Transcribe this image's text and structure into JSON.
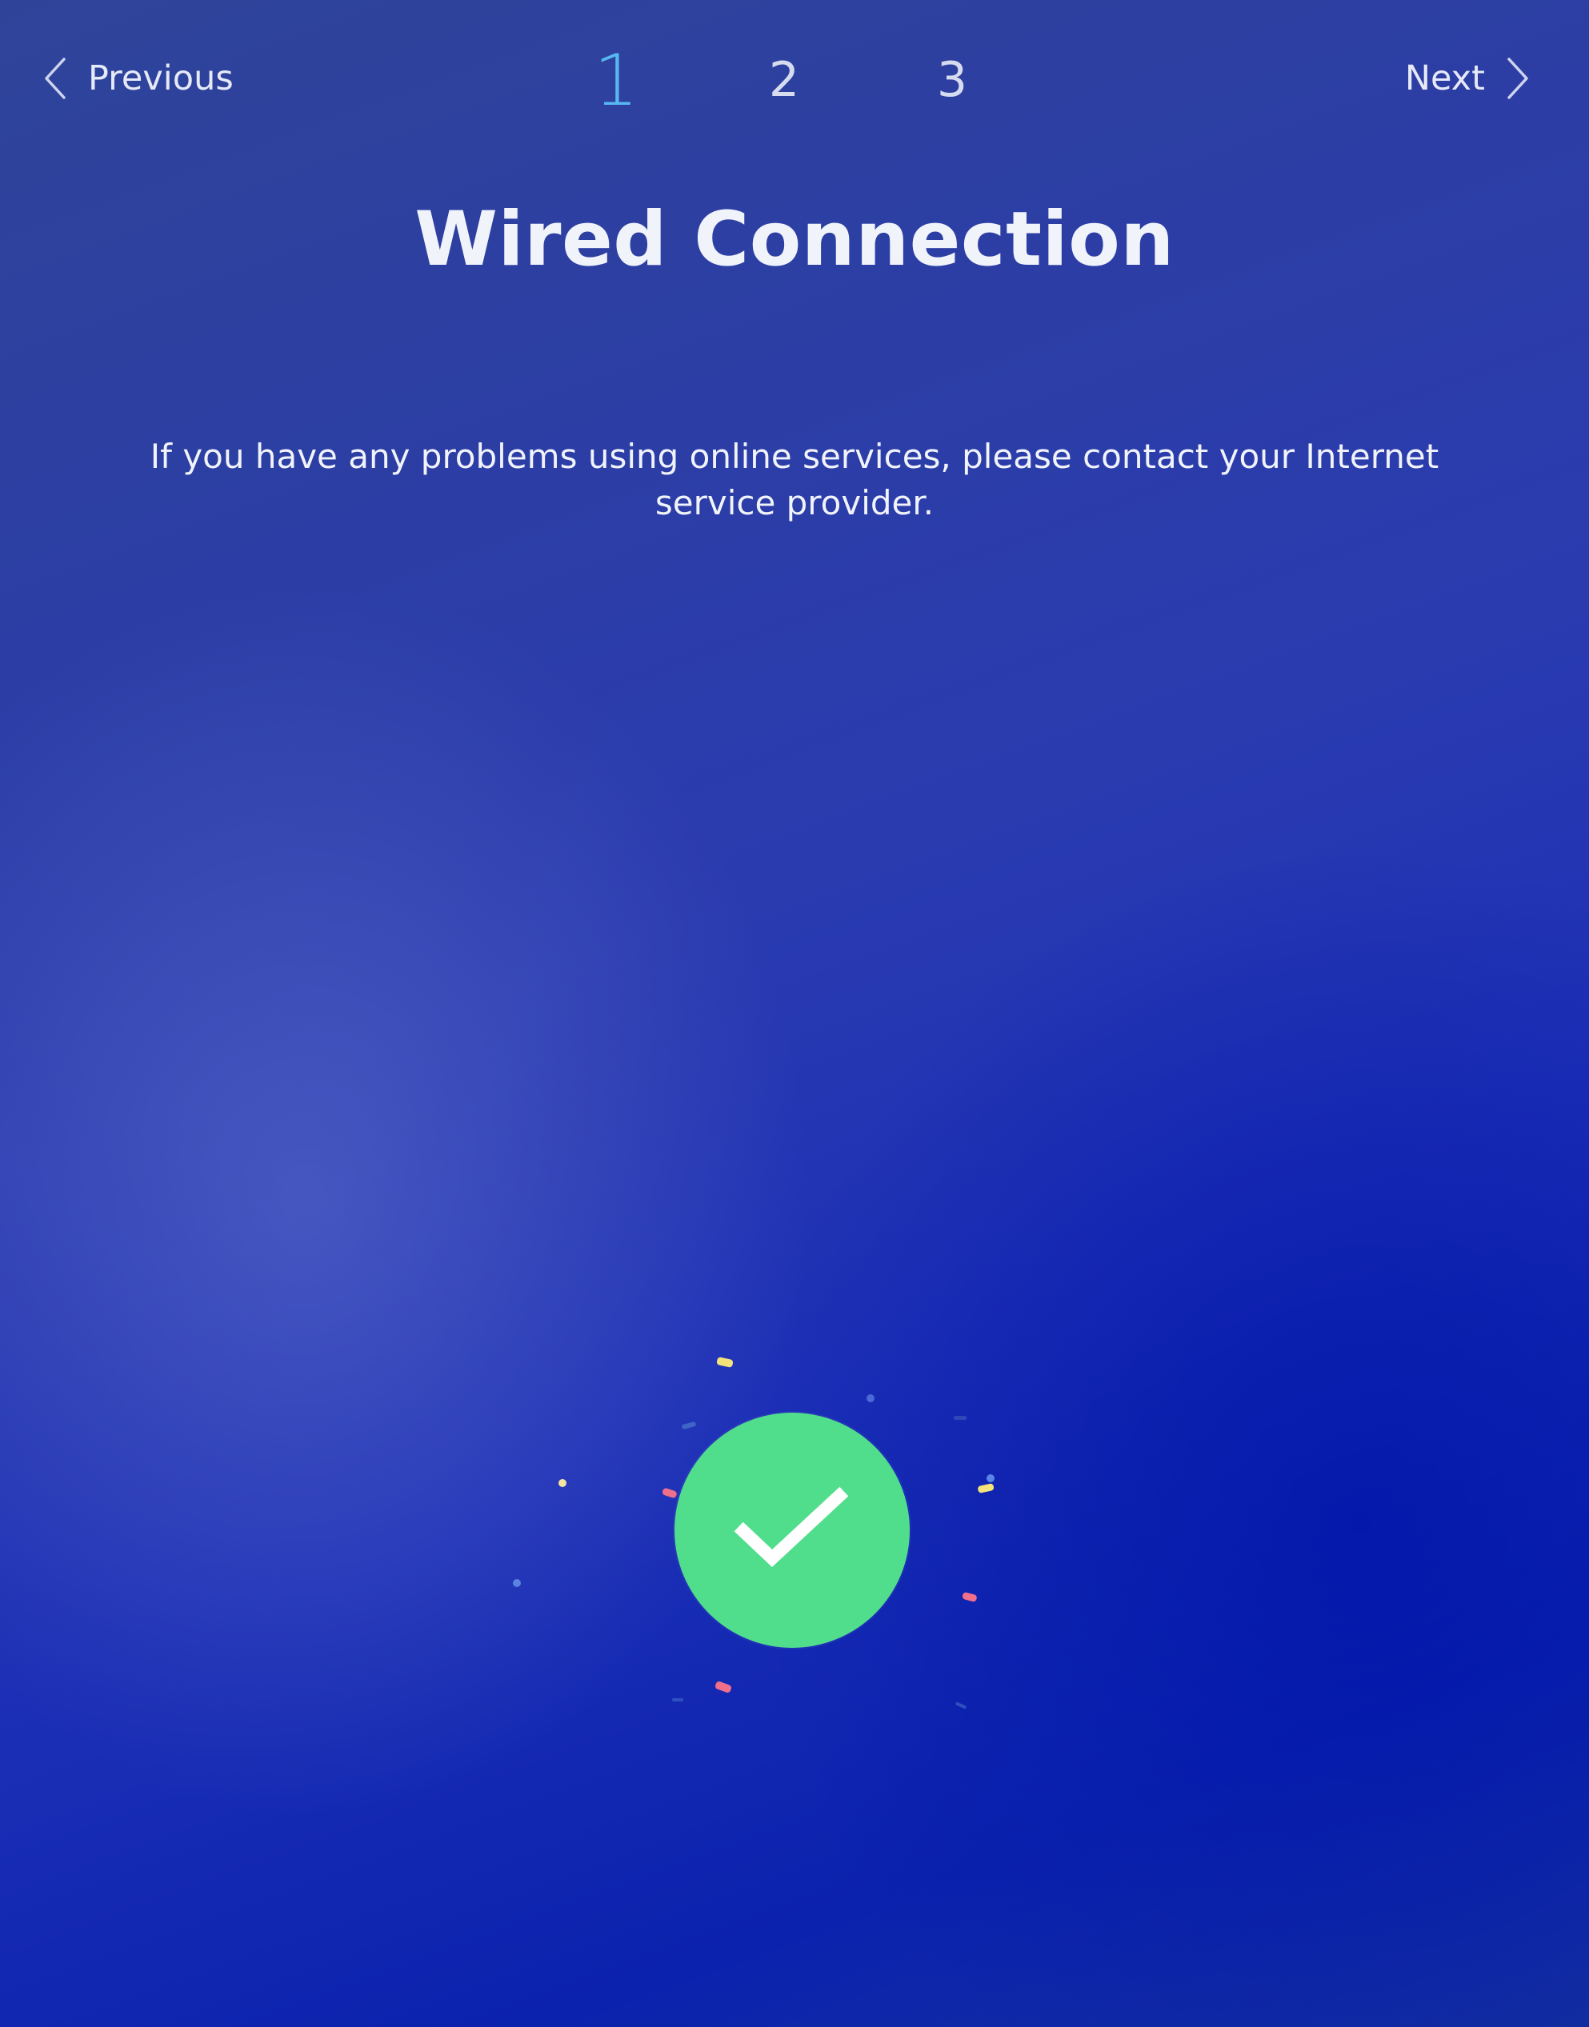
{
  "nav": {
    "previous_label": "Previous",
    "next_label": "Next"
  },
  "steps": {
    "items": [
      "1",
      "2",
      "3"
    ],
    "current": "1"
  },
  "page": {
    "title": "Wired Connection",
    "message": "If you have any problems using online services, please contact your Internet service provider."
  },
  "colors": {
    "accent_step": "#57b7f0",
    "success": "#51de8c",
    "background": "#1c2fb6"
  },
  "icons": {
    "previous": "chevron-left-icon",
    "next": "chevron-right-icon",
    "status": "checkmark-icon"
  }
}
